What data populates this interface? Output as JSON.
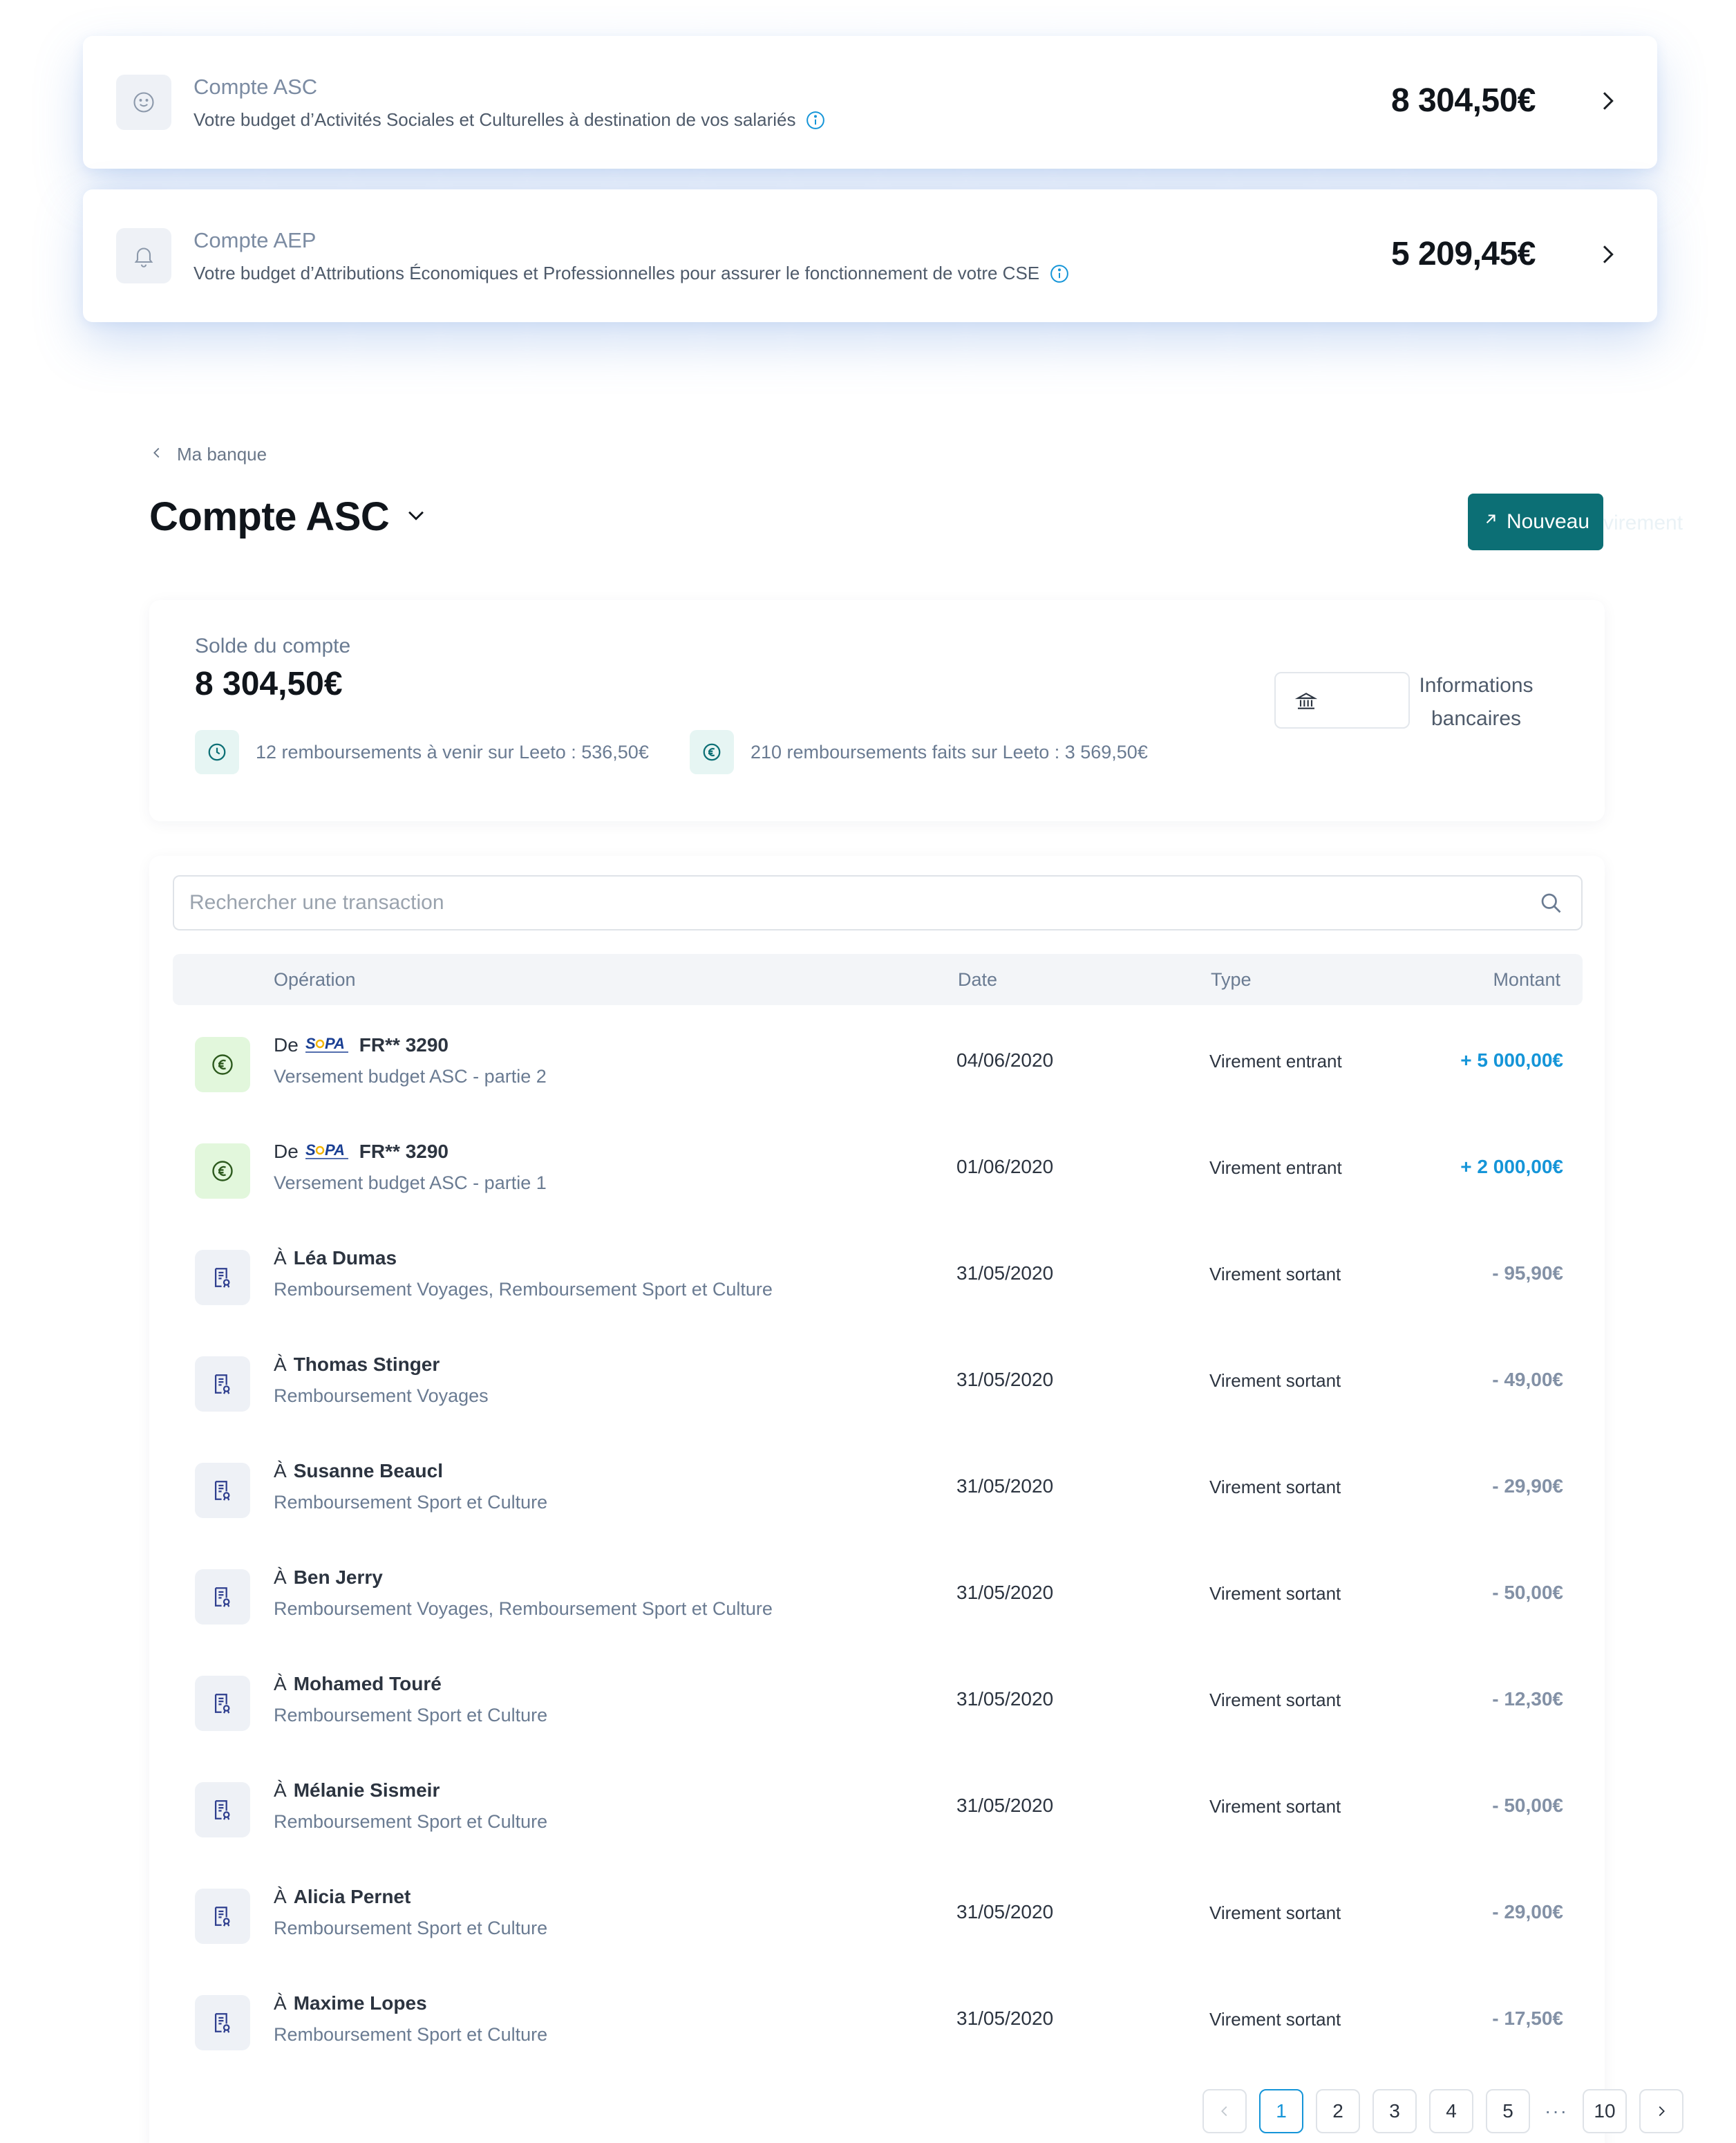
{
  "accounts": [
    {
      "title": "Compte ASC",
      "description": "Votre budget d’Activités Sociales et Culturelles à destination de vos salariés",
      "amount": "8 304,50€",
      "icon": "smile-icon"
    },
    {
      "title": "Compte AEP",
      "description": "Votre budget d’Attributions Économiques et Professionnelles pour assurer le fonctionnement de votre CSE",
      "amount": "5 209,45€",
      "icon": "bell-icon"
    }
  ],
  "header": {
    "breadcrumb": "Ma banque",
    "title": "Compte ASC",
    "new_button": "Nouveau",
    "new_button_overflow": "virement"
  },
  "balance": {
    "label": "Solde du compte",
    "amount": "8 304,50€",
    "upcoming": "12 remboursements à venir sur Leeto : 536,50€",
    "done": "210 remboursements faits sur Leeto : 3 569,50€",
    "bank_info": "Informations bancaires"
  },
  "search": {
    "placeholder": "Rechercher une transaction"
  },
  "table": {
    "headers": {
      "operation": "Opération",
      "date": "Date",
      "type": "Type",
      "amount": "Montant"
    },
    "rows": [
      {
        "direction": "in",
        "prefix": "De",
        "name": "FR** 3290",
        "detail": "Versement budget ASC - partie 2",
        "date": "04/06/2020",
        "type": "Virement entrant",
        "amount": "+ 5 000,00€"
      },
      {
        "direction": "in",
        "prefix": "De",
        "name": "FR** 3290",
        "detail": "Versement budget ASC - partie 1",
        "date": "01/06/2020",
        "type": "Virement entrant",
        "amount": "+ 2 000,00€"
      },
      {
        "direction": "out",
        "prefix": "À",
        "name": "Léa Dumas",
        "detail": "Remboursement Voyages, Remboursement Sport et Culture",
        "date": "31/05/2020",
        "type": "Virement sortant",
        "amount": "- 95,90€"
      },
      {
        "direction": "out",
        "prefix": "À",
        "name": "Thomas Stinger",
        "detail": "Remboursement Voyages",
        "date": "31/05/2020",
        "type": "Virement sortant",
        "amount": "- 49,00€"
      },
      {
        "direction": "out",
        "prefix": "À",
        "name": "Susanne Beaucl",
        "detail": "Remboursement Sport et Culture",
        "date": "31/05/2020",
        "type": "Virement sortant",
        "amount": "- 29,90€"
      },
      {
        "direction": "out",
        "prefix": "À",
        "name": "Ben Jerry",
        "detail": "Remboursement Voyages, Remboursement Sport et Culture",
        "date": "31/05/2020",
        "type": "Virement sortant",
        "amount": "- 50,00€"
      },
      {
        "direction": "out",
        "prefix": "À",
        "name": "Mohamed Touré",
        "detail": "Remboursement Sport et Culture",
        "date": "31/05/2020",
        "type": "Virement sortant",
        "amount": "- 12,30€"
      },
      {
        "direction": "out",
        "prefix": "À",
        "name": "Mélanie Sismeir",
        "detail": "Remboursement Sport et Culture",
        "date": "31/05/2020",
        "type": "Virement sortant",
        "amount": "- 50,00€"
      },
      {
        "direction": "out",
        "prefix": "À",
        "name": "Alicia Pernet",
        "detail": "Remboursement Sport et Culture",
        "date": "31/05/2020",
        "type": "Virement sortant",
        "amount": "- 29,00€"
      },
      {
        "direction": "out",
        "prefix": "À",
        "name": "Maxime Lopes",
        "detail": "Remboursement Sport et Culture",
        "date": "31/05/2020",
        "type": "Virement sortant",
        "amount": "- 17,50€"
      }
    ]
  },
  "pagination": {
    "pages": [
      "1",
      "2",
      "3",
      "4",
      "5"
    ],
    "ellipsis": "···",
    "last": "10",
    "current": "1"
  },
  "colors": {
    "accent": "#0c6f75",
    "positive": "#1595d8",
    "negative": "#8391a6"
  }
}
